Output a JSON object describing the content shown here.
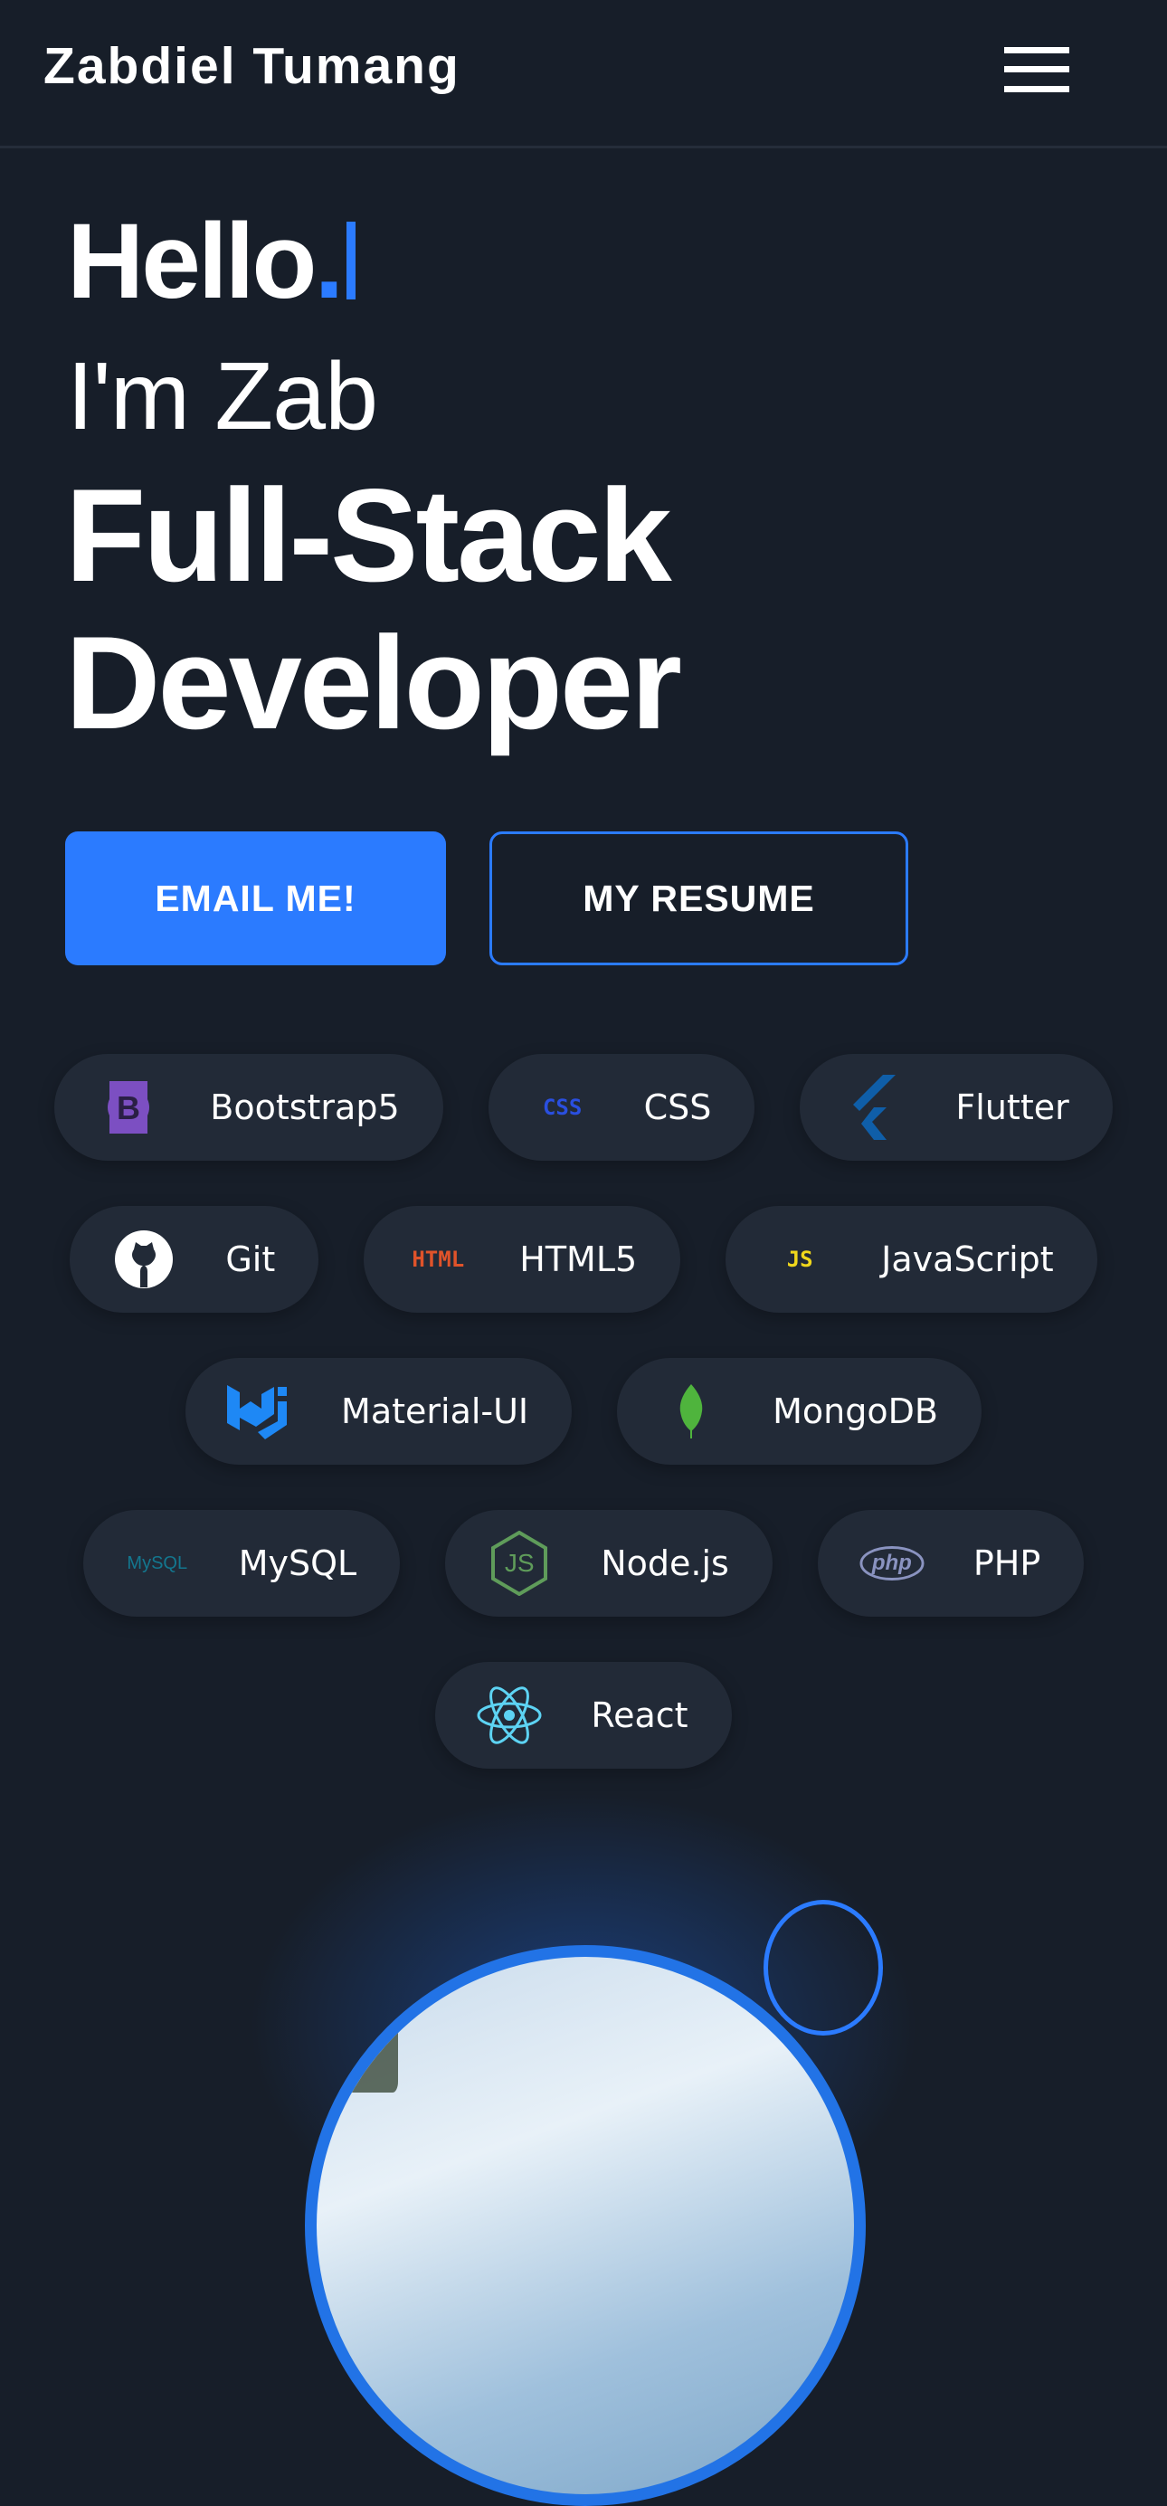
{
  "header": {
    "title": "Zabdiel Tumang",
    "menu_icon": "hamburger-icon"
  },
  "hero": {
    "hello": "Hello",
    "dot": ".",
    "intro": "I'm Zab",
    "role_line1": "Full-Stack",
    "role_line2": "Developer"
  },
  "buttons": {
    "email": "EMAIL ME!",
    "resume": "MY RESUME"
  },
  "colors": {
    "accent": "#2b7bff",
    "background": "#171e29",
    "pill": "#222a37"
  },
  "skills": [
    {
      "label": "Bootstrap5",
      "icon": "bootstrap-icon"
    },
    {
      "label": "CSS",
      "icon": "css-icon",
      "icon_text": "CSS"
    },
    {
      "label": "Flutter",
      "icon": "flutter-icon"
    },
    {
      "label": "Git",
      "icon": "github-icon"
    },
    {
      "label": "HTML5",
      "icon": "html-icon",
      "icon_text": "HTML"
    },
    {
      "label": "JavaScript",
      "icon": "js-icon",
      "icon_text": "JS"
    },
    {
      "label": "Material-UI",
      "icon": "material-ui-icon"
    },
    {
      "label": "MongoDB",
      "icon": "mongodb-icon"
    },
    {
      "label": "MySQL",
      "icon": "mysql-icon",
      "icon_text": "MySQL"
    },
    {
      "label": "Node.js",
      "icon": "nodejs-icon",
      "icon_text": "JS"
    },
    {
      "label": "PHP",
      "icon": "php-icon",
      "icon_text": "php"
    },
    {
      "label": "React",
      "icon": "react-icon"
    }
  ]
}
